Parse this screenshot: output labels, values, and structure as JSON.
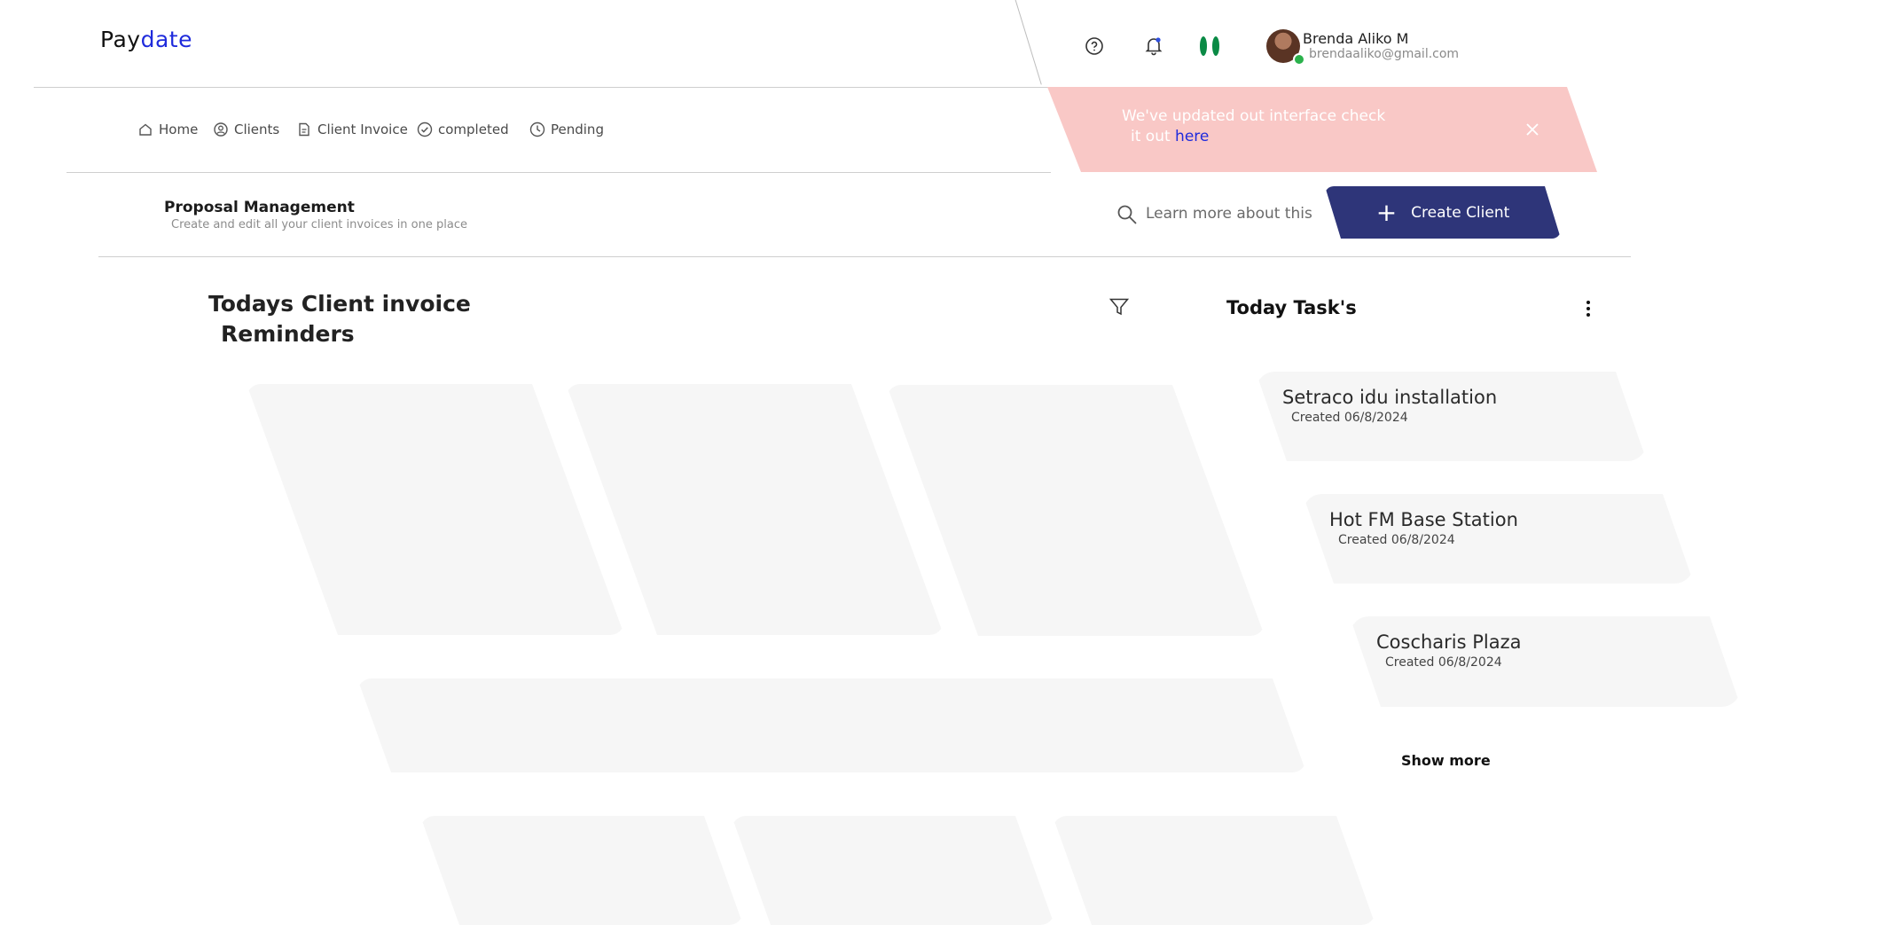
{
  "app": {
    "logo_part1": "Pay",
    "logo_part2": "date"
  },
  "user": {
    "name": "Brenda Aliko M",
    "email": "brendaaliko@gmail.com"
  },
  "header_icons": [
    "help-icon",
    "bell-icon",
    "nigeria-flag-icon",
    "avatar"
  ],
  "nav": {
    "items": [
      {
        "label": "Home",
        "icon": "home-icon"
      },
      {
        "label": "Clients",
        "icon": "clients-icon"
      },
      {
        "label": "Client Invoice",
        "icon": "invoice-icon"
      },
      {
        "label": "completed",
        "icon": "check-circle-icon"
      },
      {
        "label": "Pending",
        "icon": "clock-icon"
      }
    ]
  },
  "banner": {
    "text_line1": "We've updated out interface check",
    "text_line2": "it out ",
    "link": "here"
  },
  "page": {
    "title": "Proposal Management",
    "subtitle": "Create and edit all your client invoices in one place"
  },
  "search": {
    "label": "Learn more about this"
  },
  "create_button": {
    "label": "Create Client"
  },
  "reminders": {
    "title_line1": "Todays Client invoice",
    "title_line2": "Reminders"
  },
  "tasks": {
    "title": "Today Task's",
    "items": [
      {
        "name": "Setraco idu installation",
        "date": "Created 06/8/2024"
      },
      {
        "name": "Hot FM Base Station",
        "date": "Created 06/8/2024"
      },
      {
        "name": "Coscharis Plaza",
        "date": "Created 06/8/2024"
      }
    ],
    "show_more": "Show more"
  },
  "colors": {
    "accent": "#1f2bdc",
    "primary_button": "#2e3579",
    "banner_bg": "#f9c8c6",
    "card_bg": "#f6f6f6",
    "online": "#2bb24c"
  }
}
